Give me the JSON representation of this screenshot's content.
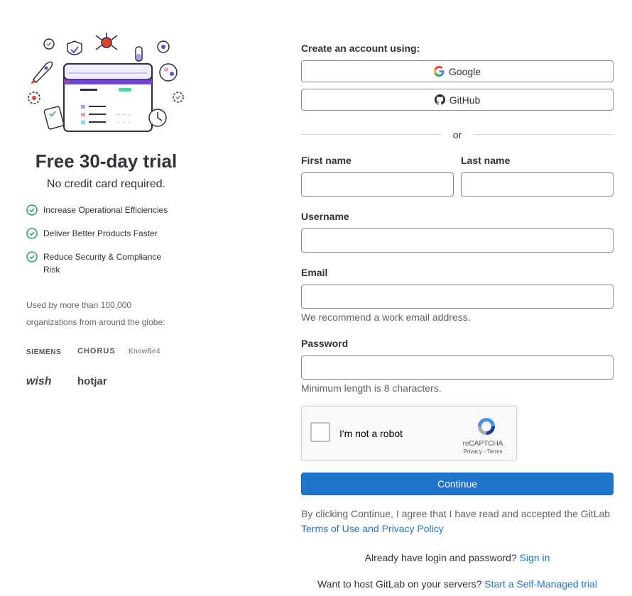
{
  "left": {
    "title": "Free 30-day trial",
    "subtitle": "No credit card required.",
    "benefits": [
      "Increase Operational Efficiencies",
      "Deliver Better Products Faster",
      "Reduce Security & Compliance Risk"
    ],
    "used_by": "Used by more than 100,000 organizations from around the globe:",
    "logos": [
      "SIEMENS",
      "CHORUS",
      "KnowBe4",
      "wish",
      "hotjar"
    ]
  },
  "form": {
    "create_label": "Create an account using:",
    "google_label": "Google",
    "github_label": "GitHub",
    "or_label": "or",
    "first_name_label": "First name",
    "last_name_label": "Last name",
    "username_label": "Username",
    "email_label": "Email",
    "email_hint": "We recommend a work email address.",
    "password_label": "Password",
    "password_hint": "Minimum length is 8 characters.",
    "first_name_value": "",
    "last_name_value": "",
    "username_value": "",
    "email_value": "",
    "password_value": ""
  },
  "recaptcha": {
    "label": "I'm not a robot",
    "brand": "reCAPTCHA",
    "links": "Privacy - Terms"
  },
  "actions": {
    "continue_label": "Continue",
    "terms_text": "By clicking Continue, I agree that I have read and accepted the GitLab ",
    "terms_link": "Terms of Use and Privacy Policy",
    "signin_text": "Already have login and password? ",
    "signin_link": "Sign in",
    "selfmanaged_text": "Want to host GitLab on your servers? ",
    "selfmanaged_link": "Start a Self-Managed trial"
  },
  "colors": {
    "primary": "#1f75cb",
    "check_green": "#2da160",
    "illustration_purple": "#6e49cb",
    "illustration_red": "#e24329"
  }
}
